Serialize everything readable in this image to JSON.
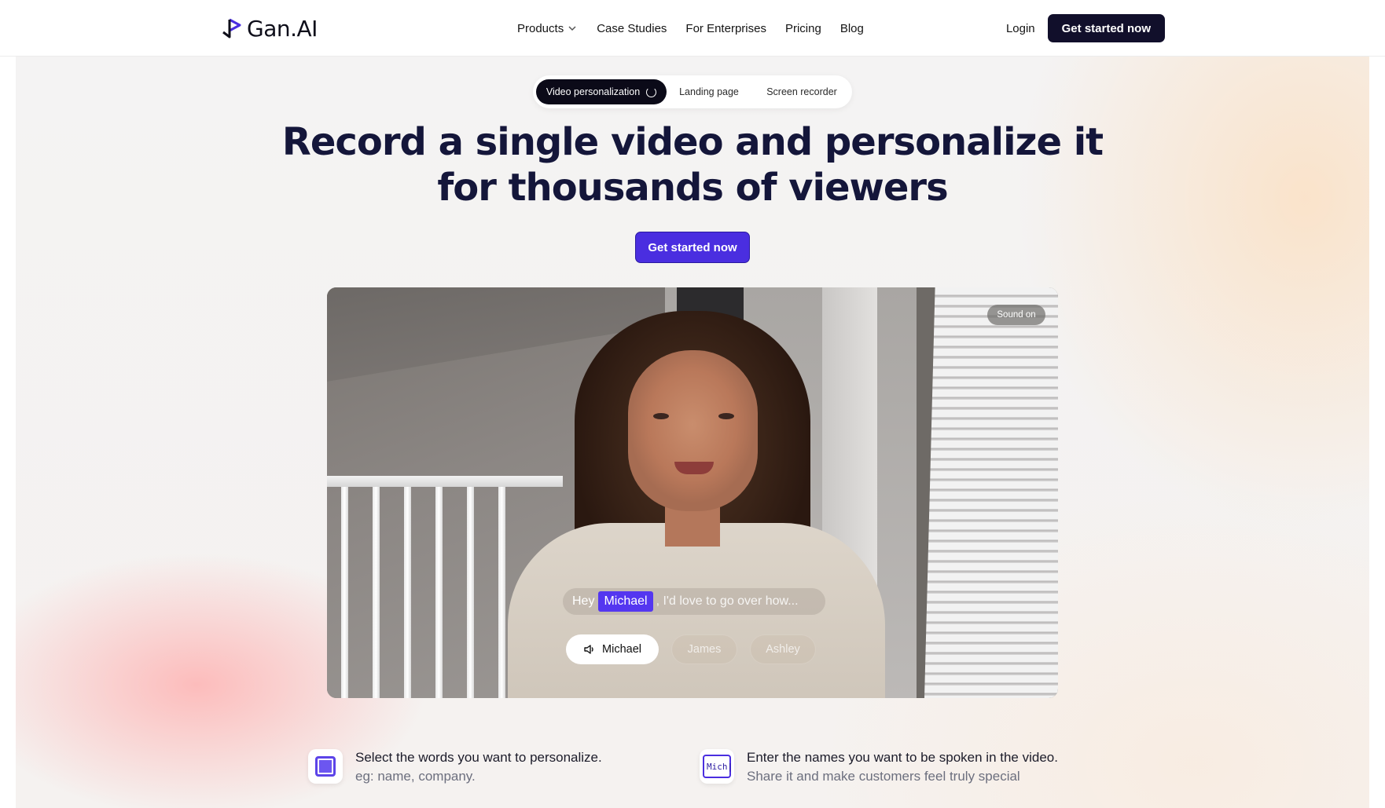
{
  "nav": {
    "brand": "Gan.AI",
    "links": [
      "Products",
      "Case Studies",
      "For Enterprises",
      "Pricing",
      "Blog"
    ],
    "login": "Login",
    "cta": "Get started now"
  },
  "tabs": [
    "Video personalization",
    "Landing page",
    "Screen recorder"
  ],
  "hero": {
    "headline": "Record a single video and personalize it for thousands of viewers",
    "cta": "Get started now"
  },
  "video": {
    "sound_badge": "Sound on",
    "caption": {
      "hey": "Hey",
      "name": "Michael",
      "rest": ", I'd love to go over how..."
    },
    "names": [
      "Michael",
      "James",
      "Ashley"
    ]
  },
  "features": [
    {
      "title": "Select the words you want to personalize.",
      "subtitle": "eg: name, company.",
      "icon": "frame-icon"
    },
    {
      "title": "Enter the names you want to be spoken in the video.",
      "subtitle": "Share it and make customers feel truly special",
      "icon": "text-input-icon",
      "icon_text": "Mich|"
    }
  ],
  "colors": {
    "primary": "#4a2ee0",
    "dark": "#110f2b",
    "headline": "#14163a"
  }
}
